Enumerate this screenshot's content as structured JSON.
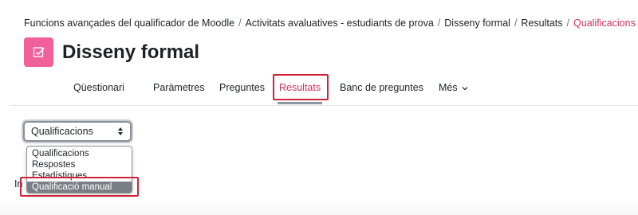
{
  "breadcrumb": {
    "items": [
      "Funcions avançades del qualificador de Moodle",
      "Activitats avaluatives - estudiants de prova",
      "Disseny formal",
      "Resultats"
    ],
    "current": "Qualificacions",
    "separator": "/"
  },
  "page": {
    "title": "Disseny formal",
    "icon": "quiz-check-icon",
    "icon_color": "#f0609a"
  },
  "tabs": {
    "items": [
      "Qüestionari",
      "Paràmetres",
      "Preguntes",
      "Resultats",
      "Banc de preguntes",
      "Més"
    ],
    "active": "Resultats",
    "more_icon": "chevron-down-icon"
  },
  "report_select": {
    "value": "Qualificacions",
    "options": [
      "Qualificacions",
      "Respostes",
      "Estadístiques",
      "Qualificació manual"
    ],
    "highlighted_option": "Qualificació manual"
  },
  "obscured_text": "In",
  "colors": {
    "accent": "#d0335c",
    "highlight_border": "#d0233a"
  }
}
